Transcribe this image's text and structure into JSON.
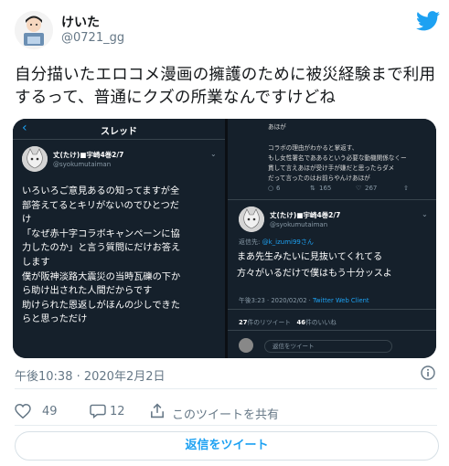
{
  "user": {
    "display_name": "けいた",
    "handle": "@0721_gg"
  },
  "tweet": {
    "text": "自分描いたエロコメ漫画の擁護のために被災経験まで利用するって、普通にクズの所業なんですけどね",
    "timestamp": "午後10:38 · 2020年2月2日"
  },
  "left_panel": {
    "header_title": "スレッド",
    "author_name": "丈(たけ)■宇崎4巻2/7",
    "author_handle": "@syokumutaiman",
    "body_lines": [
      "いろいろご意見あるの知ってますが全",
      "部答えてるとキリがないのでひとつだ",
      "け",
      "「なぜ赤十字コラボキャンペーンに協",
      "力したのか」と言う質問にだけお答え",
      "します",
      "僕が阪神淡路大震災の当時瓦礫の下か",
      "ら助け出された人間だからです",
      "助けられた恩返しがほんの少しできた",
      "らと思っただけ"
    ]
  },
  "right_panel": {
    "top_lines": [
      "あほが",
      "",
      "コラボの理由がわかると掌返す、",
      "もし女性署名でああるという必要な動機関係なくー",
      "貫して言えあほが受け手が嫌だと思ったらダメ",
      "だって言ったのはお前らやんけあほが"
    ],
    "action_counts": {
      "replies": "6",
      "retweets": "165",
      "likes": "267"
    },
    "reply_to_label": "返信先:",
    "reply_to_handle": "@k_izumi99さん",
    "author_name": "丈(たけ)■宇崎4巻2/7",
    "author_handle": "@syokumutaiman",
    "body_lines": [
      "まあ先生みたいに見抜いてくれてる",
      "方々がいるだけで僕はもう十分ッスよ"
    ],
    "meta_time": "午後3:23 · 2020/02/02 · ",
    "meta_client": "Twitter Web Client",
    "retweet_count": "27",
    "retweet_label": "件のリツイート",
    "like_count": "46",
    "like_label": "件のいいね",
    "reply_placeholder": "返信をツイート"
  },
  "actions": {
    "like_count": "49",
    "reply_count": "12",
    "share_label": "このツイートを共有"
  },
  "reply_button_label": "返信をツイート",
  "colors": {
    "accent": "#1da1f2",
    "dark_bg": "#15202b",
    "muted": "#657786"
  }
}
